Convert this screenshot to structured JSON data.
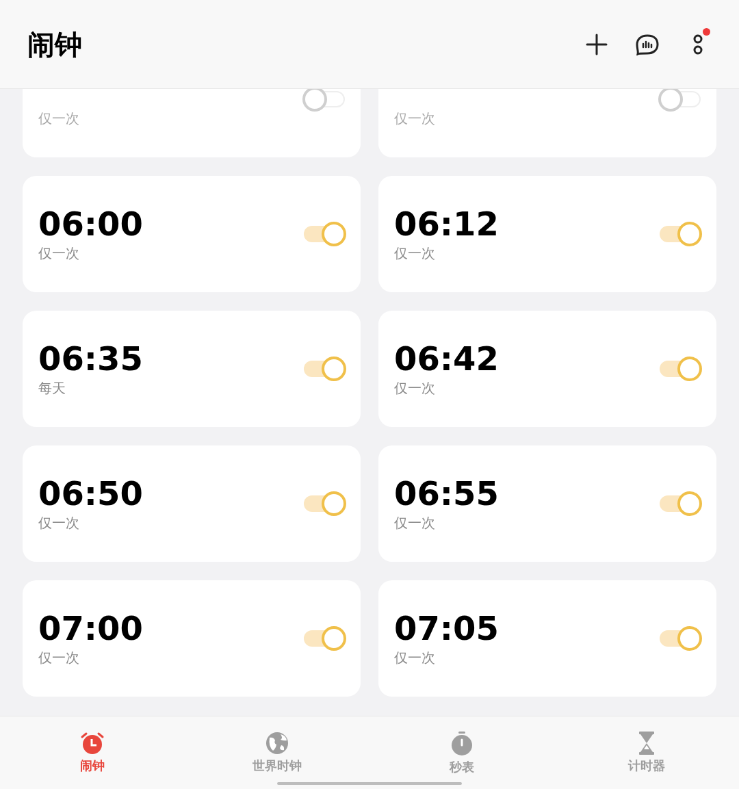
{
  "header": {
    "title": "闹钟",
    "has_notification": true
  },
  "alarms": [
    {
      "repeat": "仅一次",
      "on": false
    },
    {
      "repeat": "仅一次",
      "on": false
    },
    {
      "time": "06:00",
      "repeat": "仅一次",
      "on": true
    },
    {
      "time": "06:12",
      "repeat": "仅一次",
      "on": true
    },
    {
      "time": "06:35",
      "repeat": "每天",
      "on": true
    },
    {
      "time": "06:42",
      "repeat": "仅一次",
      "on": true
    },
    {
      "time": "06:50",
      "repeat": "仅一次",
      "on": true
    },
    {
      "time": "06:55",
      "repeat": "仅一次",
      "on": true
    },
    {
      "time": "07:00",
      "repeat": "仅一次",
      "on": true
    },
    {
      "time": "07:05",
      "repeat": "仅一次",
      "on": true
    }
  ],
  "tabs": [
    {
      "label": "闹钟",
      "kind": "alarm",
      "selected": true
    },
    {
      "label": "世界时钟",
      "kind": "world",
      "selected": false
    },
    {
      "label": "秒表",
      "kind": "stopwatch",
      "selected": false
    },
    {
      "label": "计时器",
      "kind": "timer",
      "selected": false
    }
  ]
}
